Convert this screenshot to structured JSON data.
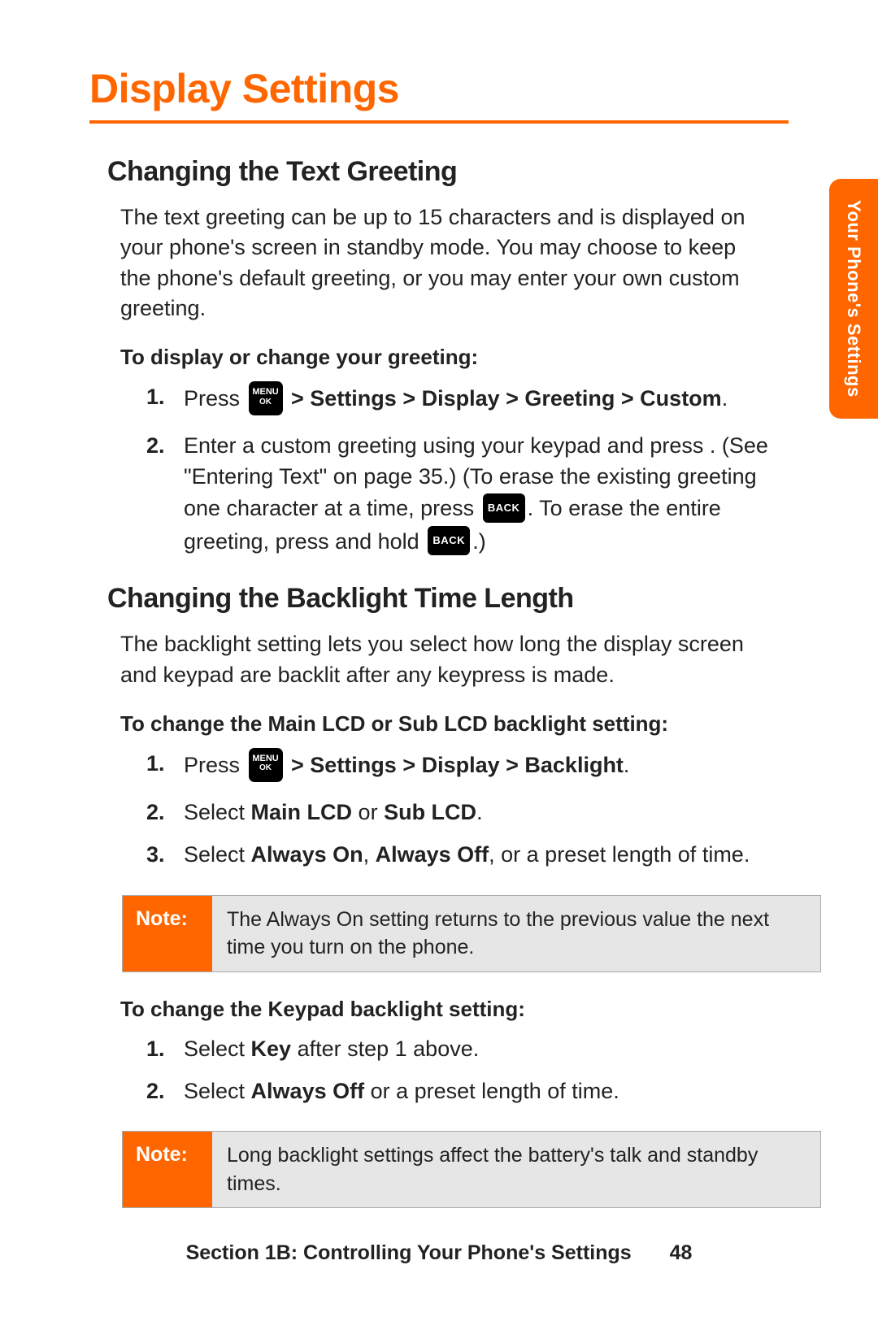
{
  "side_tab": "Your Phone's Settings",
  "page_title": "Display Settings",
  "sec1": {
    "heading": "Changing the Text Greeting",
    "intro": "The text greeting can be up to 15 characters and is displayed on your phone's screen in standby mode. You may choose to keep the phone's default greeting, or you may enter your own custom greeting.",
    "proc_lead": "To display or change your greeting:",
    "step1_press": "Press  ",
    "step1_path": " > Settings > Display > Greeting > Custom",
    "step1_dot": ".",
    "step2_a": "Enter a custom greeting using your keypad and press . (See \"Entering Text\" on page 35.) (To erase the existing greeting one character at a time, press ",
    "step2_b": ". To erase the entire greeting, press and hold ",
    "step2_c": ".)"
  },
  "sec2": {
    "heading": "Changing the Backlight Time Length",
    "intro": "The backlight setting lets you select how long the display screen and keypad are backlit after any keypress is made.",
    "procA_lead": "To change the Main LCD or Sub LCD backlight setting:",
    "a1_press": "Press  ",
    "a1_path": " > Settings > Display > Backlight",
    "a1_dot": ".",
    "a2_pre": "Select ",
    "a2_b1": "Main LCD",
    "a2_or": " or ",
    "a2_b2": "Sub LCD",
    "a2_dot": ".",
    "a3_pre": "Select ",
    "a3_b1": "Always On",
    "a3_comma": ", ",
    "a3_b2": "Always Off",
    "a3_tail": ", or a preset length of time.",
    "note1_label": "Note:",
    "note1_body": "The Always On setting returns to the previous value the next time you turn on the phone.",
    "procB_lead": "To change the Keypad backlight setting:",
    "b1_pre": "Select ",
    "b1_b": "Key",
    "b1_tail": " after step 1 above.",
    "b2_pre": "Select ",
    "b2_b": "Always Off",
    "b2_tail": " or a preset length of time.",
    "note2_label": "Note:",
    "note2_body": "Long backlight settings affect the battery's talk and standby times."
  },
  "keys": {
    "menu_top": "MENU",
    "menu_bot": "OK",
    "back": "BACK"
  },
  "footer_section": "Section 1B: Controlling Your Phone's Settings",
  "footer_page": "48"
}
